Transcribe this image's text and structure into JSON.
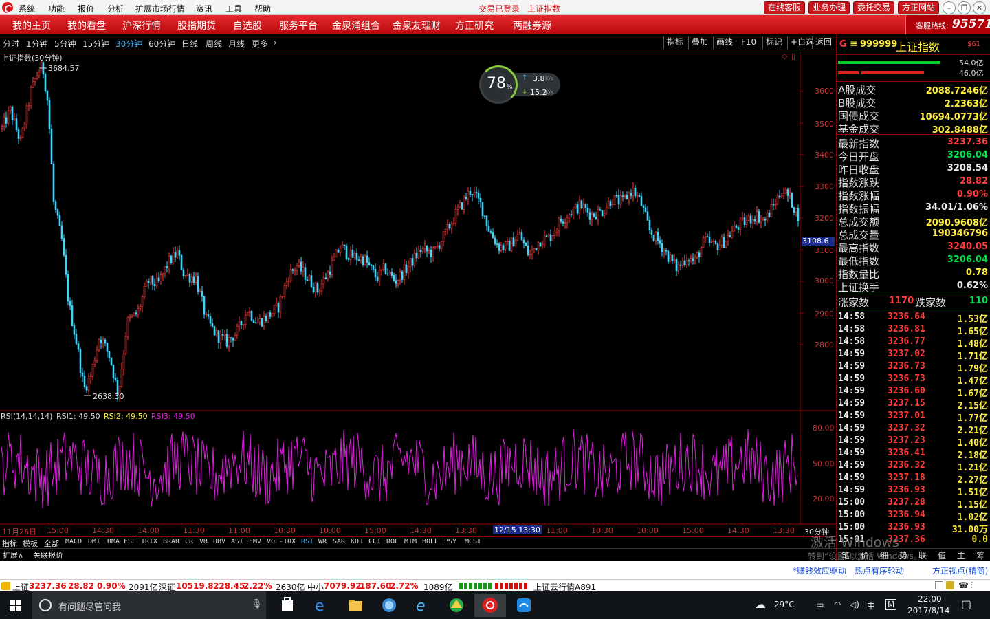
{
  "titlebar": {
    "menus": [
      "系统",
      "功能",
      "报价",
      "分析",
      "扩展市场行情",
      "资讯",
      "工具",
      "帮助"
    ],
    "status_login": "交易已登录",
    "status_index": "上证指数",
    "buttons": [
      "在线客服",
      "业务办理",
      "委托交易",
      "方正网站"
    ]
  },
  "nav": {
    "items": [
      "我的主页",
      "我的看盘",
      "沪深行情",
      "股指期货",
      "自选股",
      "服务平台",
      "金泉涌组合",
      "金泉友理财",
      "方正研究",
      "两融券源"
    ],
    "hotline_label": "客服热线:",
    "hotline_number": "95571"
  },
  "periods": {
    "items": [
      "分时",
      "1分钟",
      "5分钟",
      "15分钟",
      "30分钟",
      "60分钟",
      "日线",
      "周线",
      "月线",
      "更多"
    ],
    "active": "30分钟",
    "tools": [
      "指标",
      "叠加",
      "画线",
      "F10",
      "标记",
      "+自选",
      "返回"
    ]
  },
  "chart": {
    "title": "上证指数(30分钟)",
    "high_label": "3684.57",
    "low_label": "2638.30",
    "current_tag": "3108.6",
    "y_ticks": [
      "3600",
      "3500",
      "3400",
      "3300",
      "3200",
      "3100",
      "3000",
      "2900",
      "2800"
    ],
    "rsi_header": "RSI(14,14,14)",
    "rsi1": "RSI1: 49.50",
    "rsi2": "RSI2: 49.50",
    "rsi3": "RSI3: 49.50",
    "rsi_ticks": [
      "80.00",
      "50.00",
      "20.00"
    ],
    "x_ticks": [
      "11月26日",
      "15:00",
      "14:30",
      "14:00",
      "11:30",
      "11:00",
      "10:30",
      "10:00",
      "15:00",
      "14:30",
      "13:30",
      "12/15 13:30",
      "11:00",
      "10:30",
      "10:00",
      "15:00",
      "14:30",
      "13:30",
      "30分钟"
    ],
    "speed_percent": "78",
    "speed_unit": "%",
    "up_speed": "3.8",
    "down_speed": "15.2",
    "speed_unit_text": "K/s"
  },
  "indicator_tabs": [
    "指标",
    "模板",
    "全部",
    "MACD",
    "DMI",
    "DMA",
    "FSL",
    "TRIX",
    "BRAR",
    "CR",
    "VR",
    "OBV",
    "ASI",
    "EMV",
    "VOL-TDX",
    "RSI",
    "WR",
    "SAR",
    "KDJ",
    "CCI",
    "ROC",
    "MTM",
    "BOLL",
    "PSY",
    "MCST"
  ],
  "indicator_active": "RSI",
  "ext_tabs": [
    "扩展∧",
    "关联报价"
  ],
  "panel": {
    "code_prefix": "G",
    "code": "999999",
    "name": "上证指数",
    "tag": "$61",
    "bar_up": "54.0亿",
    "bar_down": "46.0亿",
    "turnover": [
      {
        "label": "A股成交",
        "value": "2088.7246亿"
      },
      {
        "label": "B股成交",
        "value": "2.2363亿"
      },
      {
        "label": "国债成交",
        "value": "10694.0773亿"
      },
      {
        "label": "基金成交",
        "value": "302.8488亿"
      }
    ],
    "stats": [
      {
        "label": "最新指数",
        "value": "3237.36",
        "color": "red"
      },
      {
        "label": "今日开盘",
        "value": "3206.04",
        "color": "green"
      },
      {
        "label": "昨日收盘",
        "value": "3208.54",
        "color": "white"
      },
      {
        "label": "指数涨跌",
        "value": "28.82",
        "color": "red"
      },
      {
        "label": "指数涨幅",
        "value": "0.90%",
        "color": "red"
      },
      {
        "label": "指数振幅",
        "value": "34.01/1.06%",
        "color": "white"
      },
      {
        "label": "总成交额",
        "value": "2090.9608亿",
        "color": "yellow"
      },
      {
        "label": "总成交量",
        "value": "190346796",
        "color": "yellow"
      },
      {
        "label": "最高指数",
        "value": "3240.05",
        "color": "red"
      },
      {
        "label": "最低指数",
        "value": "3206.04",
        "color": "green"
      },
      {
        "label": "指数量比",
        "value": "0.78",
        "color": "yellow"
      },
      {
        "label": "上证换手",
        "value": "0.62%",
        "color": "white"
      }
    ],
    "up_label": "涨家数",
    "up_count": "1170",
    "down_label": "跌家数",
    "down_count": "110",
    "trades": [
      {
        "time": "14:58",
        "price": "3236.64",
        "amount": "1.53亿"
      },
      {
        "time": "14:58",
        "price": "3236.81",
        "amount": "1.65亿"
      },
      {
        "time": "14:58",
        "price": "3236.77",
        "amount": "1.48亿"
      },
      {
        "time": "14:59",
        "price": "3237.02",
        "amount": "1.71亿"
      },
      {
        "time": "14:59",
        "price": "3236.73",
        "amount": "1.79亿"
      },
      {
        "time": "14:59",
        "price": "3236.73",
        "amount": "1.47亿"
      },
      {
        "time": "14:59",
        "price": "3236.60",
        "amount": "1.67亿"
      },
      {
        "time": "14:59",
        "price": "3237.15",
        "amount": "2.15亿"
      },
      {
        "time": "14:59",
        "price": "3237.01",
        "amount": "1.77亿"
      },
      {
        "time": "14:59",
        "price": "3237.32",
        "amount": "2.21亿"
      },
      {
        "time": "14:59",
        "price": "3237.23",
        "amount": "1.40亿"
      },
      {
        "time": "14:59",
        "price": "3236.41",
        "amount": "2.18亿"
      },
      {
        "time": "14:59",
        "price": "3236.32",
        "amount": "1.21亿"
      },
      {
        "time": "14:59",
        "price": "3237.18",
        "amount": "2.27亿"
      },
      {
        "time": "14:59",
        "price": "3236.93",
        "amount": "1.51亿"
      },
      {
        "time": "15:00",
        "price": "3237.28",
        "amount": "1.15亿"
      },
      {
        "time": "15:00",
        "price": "3236.94",
        "amount": "1.02亿"
      },
      {
        "time": "15:00",
        "price": "3236.93",
        "amount": "31.00万"
      },
      {
        "time": "15:01",
        "price": "3237.36",
        "amount": "0.0"
      }
    ],
    "bottom_tabs": [
      "笔",
      "价",
      "细",
      "势",
      "联",
      "值",
      "主",
      "筹"
    ],
    "watermark": "激活 Windows",
    "watermark_sub": "转到“设置”以激活 Windows。"
  },
  "infostrip": [
    "*赚钱效应驱动",
    "热点有序轮动",
    "方正视点(精简)"
  ],
  "ticker": {
    "sh_label": "上证",
    "sh_value": "3237.36",
    "sh_change": "28.82",
    "sh_pct": "0.90%",
    "sh_amount": "2091亿",
    "sz_label": "深证",
    "sz_value": "10519.8",
    "sz_change": "228.45",
    "sz_pct": "2.22%",
    "sz_amount": "2630亿",
    "zx_label": "中小",
    "zx_value": "7079.92",
    "zx_change": "187.60",
    "zx_pct": "2.72%",
    "zx_amount": "1089亿",
    "cloud": "上证云行情A891"
  },
  "taskbar": {
    "search_placeholder": "有问题尽管问我",
    "weather": "29°C",
    "ime": "中",
    "time": "22:00",
    "date": "2017/8/14"
  },
  "colors": {
    "up": "#ff3b3b",
    "down": "#3fd5ff",
    "rsi": "#e020e0",
    "brand_red": "#d9161c"
  }
}
